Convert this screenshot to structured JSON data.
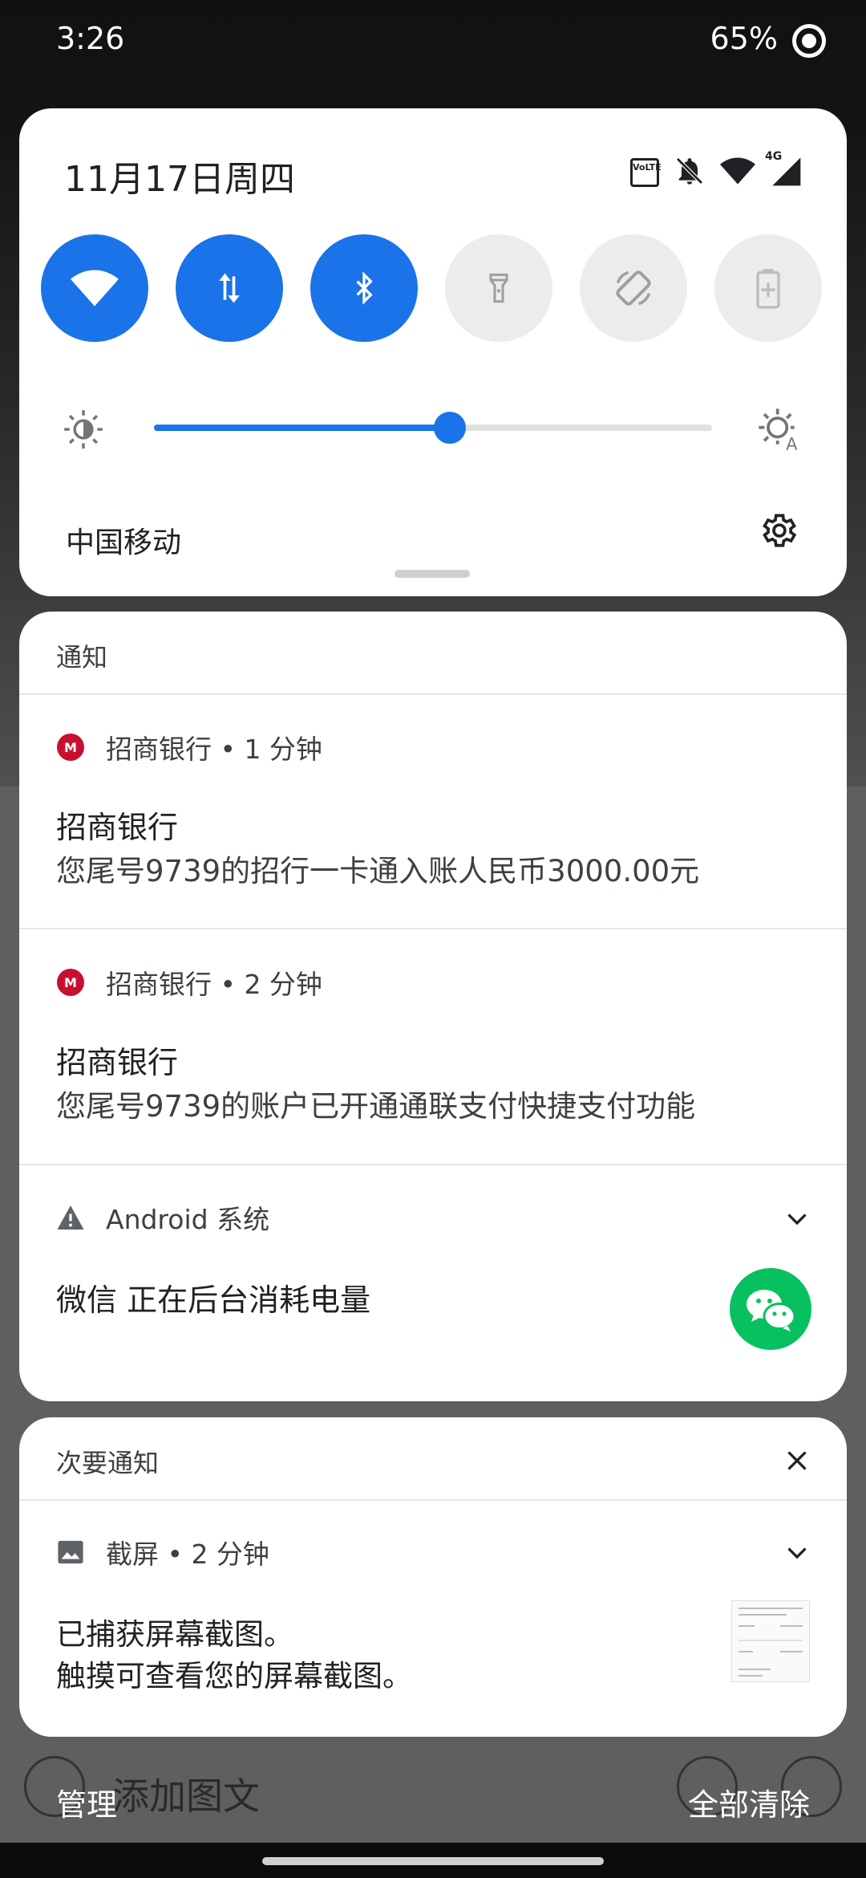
{
  "status_bar": {
    "time": "3:26",
    "battery": "65%"
  },
  "quick_settings": {
    "date": "11月17日周四",
    "volte_label": "VoLTE",
    "network_label": "4G",
    "tiles": [
      {
        "name": "wifi",
        "state": "on"
      },
      {
        "name": "mobile-data",
        "state": "on"
      },
      {
        "name": "bluetooth",
        "state": "on"
      },
      {
        "name": "flashlight",
        "state": "off"
      },
      {
        "name": "auto-rotate",
        "state": "off"
      },
      {
        "name": "battery-saver",
        "state": "off"
      }
    ],
    "brightness_level": 0.53,
    "carrier": "中国移动",
    "accent_color": "#1a73e8"
  },
  "notifications": {
    "header": "通知",
    "items": [
      {
        "app_line": "招商银行 • 1 分钟",
        "title": "招商银行",
        "text": "您尾号9739的招行一卡通入账人民币3000.00元"
      },
      {
        "app_line": "招商银行 • 2 分钟",
        "title": "招商银行",
        "text": "您尾号9739的账户已开通通联支付快捷支付功能"
      },
      {
        "app_line": "Android 系统",
        "text": "微信 正在后台消耗电量"
      }
    ]
  },
  "silent": {
    "header": "次要通知",
    "item": {
      "app_line": "截屏 • 2 分钟",
      "line1": "已捕获屏幕截图。",
      "line2": "触摸可查看您的屏幕截图。"
    }
  },
  "footer": {
    "manage": "管理",
    "clear_all": "全部清除",
    "behind_placeholder": "添加图文"
  }
}
